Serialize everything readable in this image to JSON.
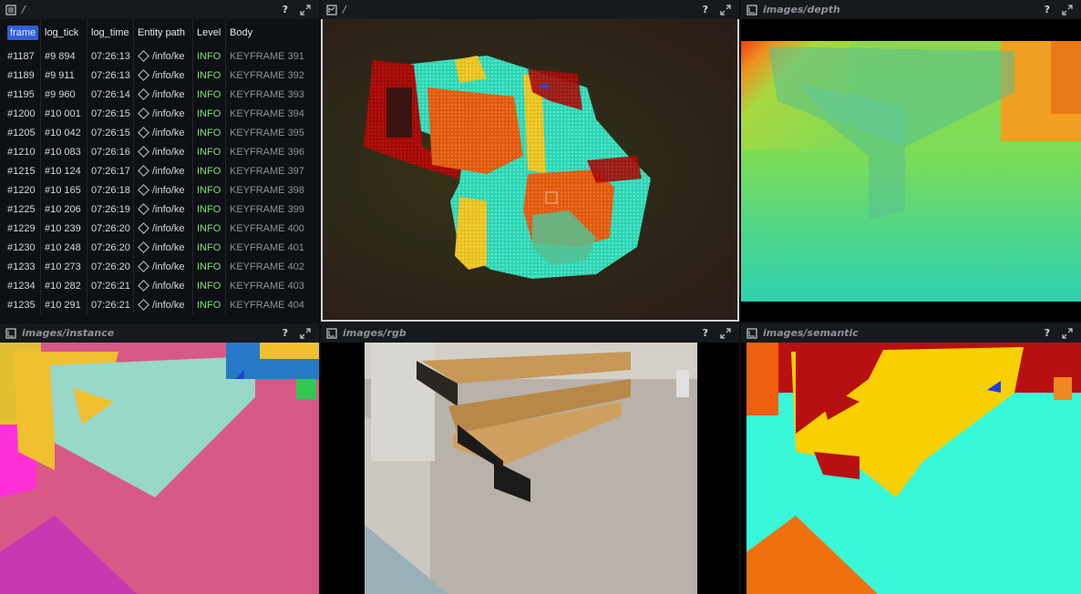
{
  "panels": {
    "log": {
      "title": "/",
      "help": "?"
    },
    "spatial3d": {
      "title": "/",
      "help": "?"
    },
    "depth": {
      "title": "images/depth",
      "help": "?"
    },
    "instance": {
      "title": "images/instance",
      "help": "?"
    },
    "rgb": {
      "title": "images/rgb",
      "help": "?"
    },
    "semantic": {
      "title": "images/semantic",
      "help": "?"
    }
  },
  "table": {
    "columns": [
      "frame",
      "log_tick",
      "log_time",
      "Entity path",
      "Level",
      "Body"
    ],
    "rows": [
      [
        "#1187",
        "#9 894",
        "07:26:13",
        "/info/ke",
        "INFO",
        "KEYFRAME 391"
      ],
      [
        "#1189",
        "#9 911",
        "07:26:13",
        "/info/ke",
        "INFO",
        "KEYFRAME 392"
      ],
      [
        "#1195",
        "#9 960",
        "07:26:14",
        "/info/ke",
        "INFO",
        "KEYFRAME 393"
      ],
      [
        "#1200",
        "#10 001",
        "07:26:15",
        "/info/ke",
        "INFO",
        "KEYFRAME 394"
      ],
      [
        "#1205",
        "#10 042",
        "07:26:15",
        "/info/ke",
        "INFO",
        "KEYFRAME 395"
      ],
      [
        "#1210",
        "#10 083",
        "07:26:16",
        "/info/ke",
        "INFO",
        "KEYFRAME 396"
      ],
      [
        "#1215",
        "#10 124",
        "07:26:17",
        "/info/ke",
        "INFO",
        "KEYFRAME 397"
      ],
      [
        "#1220",
        "#10 165",
        "07:26:18",
        "/info/ke",
        "INFO",
        "KEYFRAME 398"
      ],
      [
        "#1225",
        "#10 206",
        "07:26:19",
        "/info/ke",
        "INFO",
        "KEYFRAME 399"
      ],
      [
        "#1229",
        "#10 239",
        "07:26:20",
        "/info/ke",
        "INFO",
        "KEYFRAME 400"
      ],
      [
        "#1230",
        "#10 248",
        "07:26:20",
        "/info/ke",
        "INFO",
        "KEYFRAME 401"
      ],
      [
        "#1233",
        "#10 273",
        "07:26:20",
        "/info/ke",
        "INFO",
        "KEYFRAME 402"
      ],
      [
        "#1234",
        "#10 282",
        "07:26:21",
        "/info/ke",
        "INFO",
        "KEYFRAME 403"
      ],
      [
        "#1235",
        "#10 291",
        "07:26:21",
        "/info/ke",
        "INFO",
        "KEYFRAME 404"
      ]
    ]
  },
  "colors": {
    "sort_badge": "#2f5fd8",
    "info_level": "#7ee17a",
    "body_text": "#8c939a",
    "selected_border": "#d0d0d0"
  },
  "icons": {
    "log_view": "text-log-icon",
    "spatial_view": "3d-view-icon",
    "image_view": "image-view-icon",
    "help": "question-mark",
    "maximize": "maximize-icon",
    "entity": "entity-diamond-icon"
  }
}
